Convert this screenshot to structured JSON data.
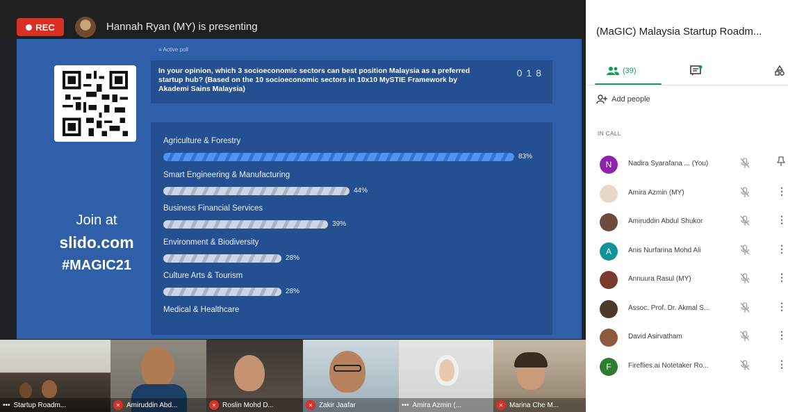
{
  "recording": {
    "label": "REC",
    "color": "#d93025"
  },
  "presenter": {
    "text": "Hannah Ryan (MY) is presenting"
  },
  "slide": {
    "join_line1": "Join at",
    "join_line2": "slido.com",
    "join_line3": "#MAGIC21",
    "poll_tag": "≡ Active poll",
    "question": "In your opinion, which 3 socioeconomic sectors can best position Malaysia as a preferred startup hub? (Based on the 10 socioeconomic sectors in 10x10 MySTIE Framework by Akademi Sains Malaysia)",
    "vote_count": "018",
    "options": [
      {
        "label": "Agriculture & Forestry",
        "percent": 83,
        "percent_label": "83%"
      },
      {
        "label": "Smart Engineering & Manufacturing",
        "percent": 44,
        "percent_label": "44%"
      },
      {
        "label": "Business Financial Services",
        "percent": 39,
        "percent_label": "39%"
      },
      {
        "label": "Environment & Biodiversity",
        "percent": 28,
        "percent_label": "28%"
      },
      {
        "label": "Culture Arts & Tourism",
        "percent": 28,
        "percent_label": "28%"
      },
      {
        "label": "Medical & Healthcare",
        "percent": null,
        "percent_label": ""
      }
    ]
  },
  "thumbnails": [
    {
      "name": "Startup Roadm...",
      "muted": false
    },
    {
      "name": "Amiruddin Abd...",
      "muted": true
    },
    {
      "name": "Roslin Mohd D...",
      "muted": true
    },
    {
      "name": "Zakir Jaafar",
      "muted": true
    },
    {
      "name": "Amira Azmin (...",
      "muted": false
    },
    {
      "name": "Marina Che M...",
      "muted": true
    }
  ],
  "panel": {
    "title": "(MaGIC) Malaysia Startup Roadm...",
    "people_tab_label": "(39)",
    "add_people": "Add people",
    "in_call_heading": "IN CALL",
    "participants": [
      {
        "name": "Nadira Syarafana ... (You)",
        "initial": "N",
        "avatar_color": "#8e24aa",
        "more": "pin-icon"
      },
      {
        "name": "Amira Azmin (MY)",
        "initial": "",
        "avatar_color": "#e9d7c8",
        "more": "more-icon"
      },
      {
        "name": "Amiruddin Abdul Shukor",
        "initial": "",
        "avatar_color": "#6d4c3d",
        "more": "more-icon"
      },
      {
        "name": "Anis Nurfarina Mohd Ali",
        "initial": "A",
        "avatar_color": "#12939a",
        "more": "more-icon"
      },
      {
        "name": "Annuura Rasul (MY)",
        "initial": "",
        "avatar_color": "#7a3b2e",
        "more": "more-icon"
      },
      {
        "name": "Assoc. Prof. Dr. Akmal S...",
        "initial": "",
        "avatar_color": "#4b3a2a",
        "more": "more-icon"
      },
      {
        "name": "David Asirvatham",
        "initial": "",
        "avatar_color": "#8d5a3b",
        "more": "more-icon"
      },
      {
        "name": "Fireflies.ai Notetaker Ro...",
        "initial": "F",
        "avatar_color": "#2e7d32",
        "more": "more-icon"
      }
    ]
  }
}
